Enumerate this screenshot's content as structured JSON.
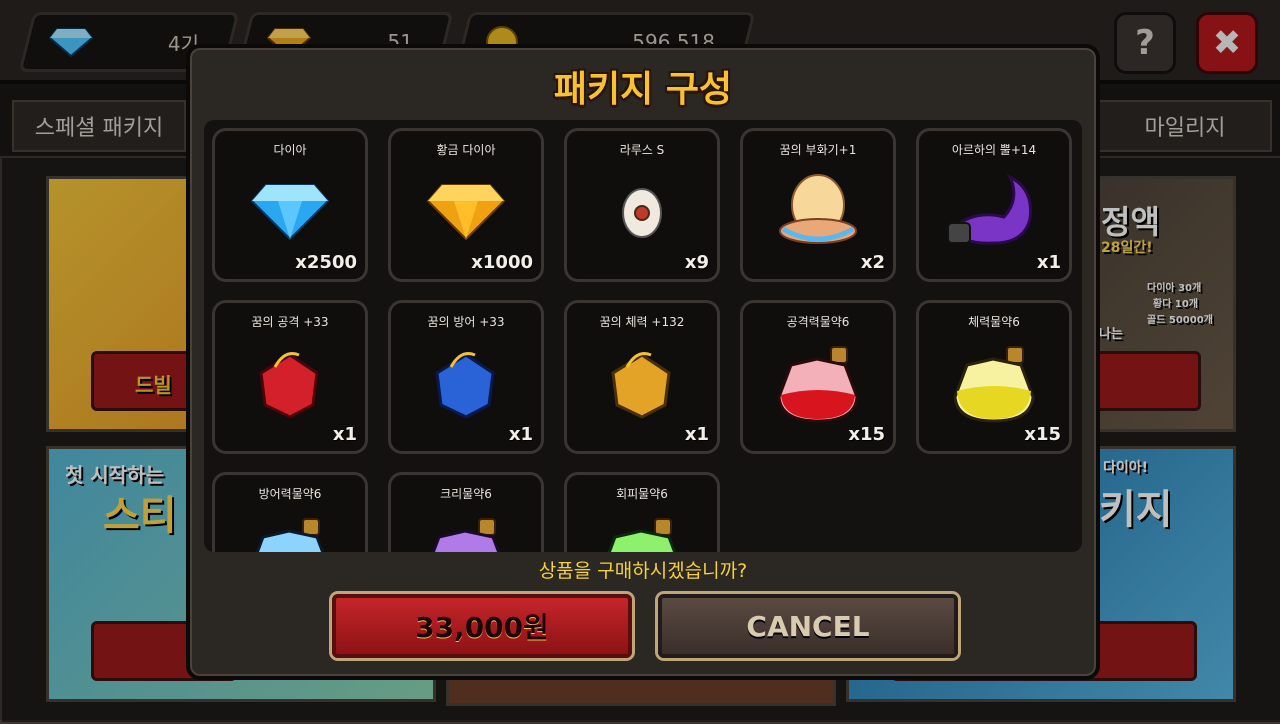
{
  "resources": [
    {
      "icon": "diamond-icon",
      "value": "4기"
    },
    {
      "icon": "gold-diamond-icon",
      "value": "51"
    },
    {
      "icon": "coin-icon",
      "value": "596,518"
    }
  ],
  "tabs": {
    "special_package": "스페셜 패키지",
    "mileage": "마일리지"
  },
  "background": {
    "banner1_button": "드빌",
    "banner2_text": "첫 시작하는",
    "banner2_title": "스티",
    "banner3_title": "정액",
    "banner3_sub": "28일간!",
    "banner3_lines": [
      "다이아 30개",
      "황다 10개",
      "골드 50000개"
    ],
    "banner3_badge": "나는",
    "banner4_top": "다이아!",
    "banner4_title": "키지"
  },
  "modal": {
    "title": "패키지 구성",
    "question": "상품을 구매하시겠습니까?",
    "buy_label": "33,000원",
    "cancel_label": "CANCEL",
    "items": [
      {
        "name": "다이아",
        "qty": "x2500",
        "icon": "diamond-icon"
      },
      {
        "name": "황금 다이아",
        "qty": "x1000",
        "icon": "gold-diamond-icon"
      },
      {
        "name": "라루스 S",
        "qty": "x9",
        "icon": "egg-icon"
      },
      {
        "name": "꿈의 부화기+1",
        "qty": "x2",
        "icon": "incubator-icon"
      },
      {
        "name": "아르하의 뿔+14",
        "qty": "x1",
        "icon": "horn-icon"
      },
      {
        "name": "꿈의 공격 +33",
        "qty": "x1",
        "icon": "red-gem-icon"
      },
      {
        "name": "꿈의 방어 +33",
        "qty": "x1",
        "icon": "blue-gem-icon"
      },
      {
        "name": "꿈의 체력 +132",
        "qty": "x1",
        "icon": "yellow-gem-icon"
      },
      {
        "name": "공격력물약6",
        "qty": "x15",
        "icon": "red-potion-icon"
      },
      {
        "name": "체력물약6",
        "qty": "x15",
        "icon": "yellow-potion-icon"
      },
      {
        "name": "방어력물약6",
        "qty": "",
        "icon": "blue-potion-icon"
      },
      {
        "name": "크리물약6",
        "qty": "",
        "icon": "purple-potion-icon"
      },
      {
        "name": "회피물약6",
        "qty": "",
        "icon": "green-potion-icon"
      }
    ]
  },
  "colors": {
    "title_gold": "#f6c232",
    "buy_red": "#c4262a",
    "question_yellow": "#f4d23a"
  }
}
